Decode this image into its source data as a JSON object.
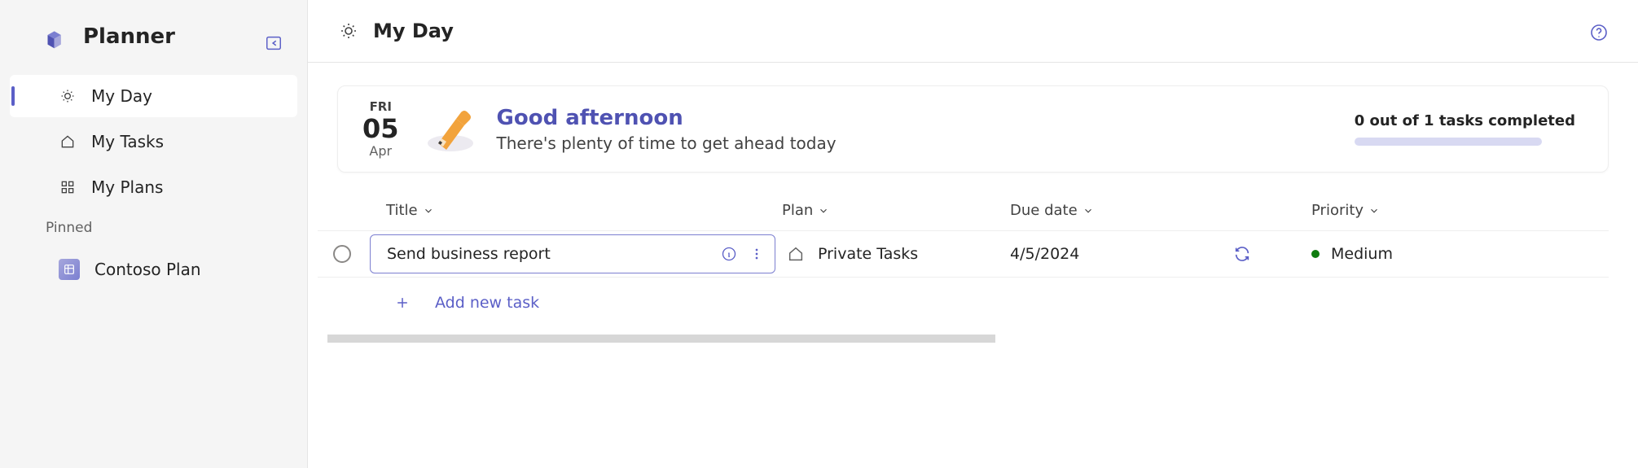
{
  "app": {
    "name": "Planner"
  },
  "sidebar": {
    "items": [
      {
        "id": "my-day",
        "label": "My Day",
        "icon": "sun-icon",
        "active": true
      },
      {
        "id": "my-tasks",
        "label": "My Tasks",
        "icon": "home-outline-icon",
        "active": false
      },
      {
        "id": "my-plans",
        "label": "My Plans",
        "icon": "grid-icon",
        "active": false
      }
    ],
    "pinned_label": "Pinned",
    "pinned_items": [
      {
        "id": "contoso-plan",
        "label": "Contoso Plan",
        "icon": "plan-tile-icon"
      }
    ]
  },
  "header": {
    "title": "My Day",
    "icon": "sun-icon"
  },
  "banner": {
    "date": {
      "dow": "FRI",
      "day": "05",
      "month": "Apr"
    },
    "greeting_title": "Good afternoon",
    "greeting_sub": "There's plenty of time to get ahead today",
    "progress_text": "0 out of 1 tasks completed",
    "progress_value": 0,
    "progress_max": 1
  },
  "columns": {
    "title": "Title",
    "plan": "Plan",
    "due": "Due date",
    "priority": "Priority"
  },
  "tasks": [
    {
      "title": "Send business report",
      "plan": "Private Tasks",
      "due": "4/5/2024",
      "recurring": true,
      "priority": "Medium",
      "priority_color": "#0f7c0f",
      "completed": false
    }
  ],
  "add_new_label": "Add new task"
}
